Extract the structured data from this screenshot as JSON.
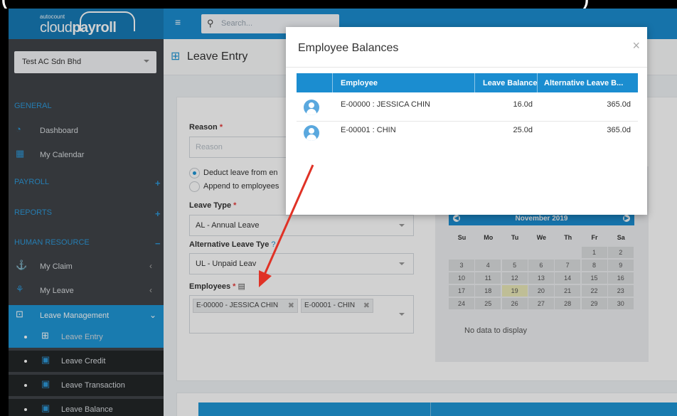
{
  "top_banner": {
    "left": "(",
    "right": ")"
  },
  "app": {
    "brand_small": "autocount",
    "brand_light": "cloud",
    "brand_bold": "payroll"
  },
  "search": {
    "placeholder": "Search..."
  },
  "company": {
    "value": "Test AC Sdn Bhd"
  },
  "sidebar": {
    "sections": {
      "general": "GENERAL",
      "payroll": "PAYROLL",
      "reports": "REPORTS",
      "hr": "HUMAN RESOURCE"
    },
    "items": {
      "dashboard": "Dashboard",
      "calendar": "My Calendar",
      "claim": "My Claim",
      "leave": "My Leave",
      "leave_mgmt": "Leave Management",
      "leave_entry": "Leave Entry",
      "leave_credit": "Leave Credit",
      "leave_transaction": "Leave Transaction",
      "leave_balance": "Leave Balance"
    }
  },
  "page": {
    "title": "Leave Entry"
  },
  "form": {
    "reason_label": "Reason",
    "reason_placeholder": "Reason",
    "radio1": "Deduct leave from en",
    "radio2": "Append to employees",
    "leave_type_label": "Leave Type",
    "leave_type_value": "AL - Annual Leave",
    "alt_leave_label": "Alternative Leave Ty",
    "alt_leave_label_tail": "e",
    "alt_leave_help": "?",
    "alt_leave_value": "UL - Unpaid Leav",
    "employees_label": "Employees",
    "required_mark": "*",
    "tags": [
      "E-00000 - JESSICA CHIN",
      "E-00001 - CHIN"
    ],
    "tag_remove": "✖"
  },
  "calendar": {
    "month": "November 2019",
    "days_of_week": [
      "Su",
      "Mo",
      "Tu",
      "We",
      "Th",
      "Fr",
      "Sa"
    ],
    "weeks": [
      [
        "",
        "",
        "",
        "",
        "",
        "1",
        "2"
      ],
      [
        "3",
        "4",
        "5",
        "6",
        "7",
        "8",
        "9"
      ],
      [
        "10",
        "11",
        "12",
        "13",
        "14",
        "15",
        "16"
      ],
      [
        "17",
        "18",
        "19",
        "20",
        "21",
        "22",
        "23"
      ],
      [
        "24",
        "25",
        "26",
        "27",
        "28",
        "29",
        "30"
      ]
    ],
    "today": "19",
    "empty_text": "No data to display"
  },
  "modal": {
    "title": "Employee Balances",
    "close": "×",
    "columns": [
      "Employee",
      "Leave Balance",
      "Alternative Leave B..."
    ],
    "rows": [
      {
        "employee": "E-00000 : JESSICA CHIN",
        "leave_balance": "16.0d",
        "alt_balance": "365.0d"
      },
      {
        "employee": "E-00001 : CHIN",
        "leave_balance": "25.0d",
        "alt_balance": "365.0d"
      }
    ]
  },
  "colors": {
    "primary": "#1b8dd0",
    "sidebar": "#404448",
    "annotation_arrow": "#e03226"
  }
}
